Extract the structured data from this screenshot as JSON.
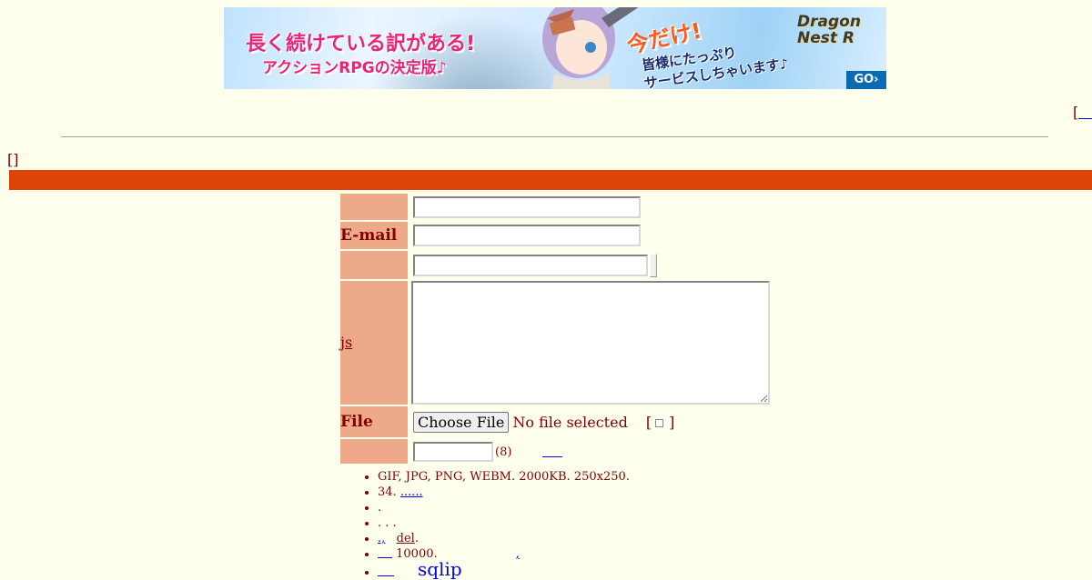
{
  "banner": {
    "headline": "長く続けている訳がある!",
    "subline": "アクションRPGの決定版♪",
    "promo_main": "今だけ!",
    "promo_sub1": "皆様にたっぷり",
    "promo_sub2": "サービスしちゃいます♪",
    "logo_line1": "Dragon",
    "logo_line2": "Nest R",
    "go_label": "GO›",
    "colors": {
      "pink": "#e8237a",
      "orange": "#ff5a1e",
      "go_blue": "#0a6bb4"
    }
  },
  "header": {
    "top_bracket": "[",
    "small_bracket": "[]"
  },
  "theme": {
    "bar_color": "#dd4408",
    "label_bg": "#eeaa88",
    "text_color": "#800000",
    "page_bg": "#ffffee"
  },
  "form": {
    "rows": {
      "email_label": "E-mail",
      "js_label": "js",
      "file_label": "File"
    },
    "file": {
      "button_label": "Choose File",
      "status": "No file selected",
      "option_open": "[",
      "option_close": "]"
    },
    "password": {
      "hint": "(8)"
    }
  },
  "rules": {
    "item1": "GIF, JPG, PNG, WEBM. 2000KB. 250x250.",
    "item2_text": "34.",
    "item2_link": "......",
    "item3": ".",
    "item4": ". . .",
    "item5_link": ".,",
    "item5_del": "del",
    "item5_end": ".",
    "item6_text": "10000.",
    "item6_tail": ",",
    "item7_link": "sqlip"
  }
}
